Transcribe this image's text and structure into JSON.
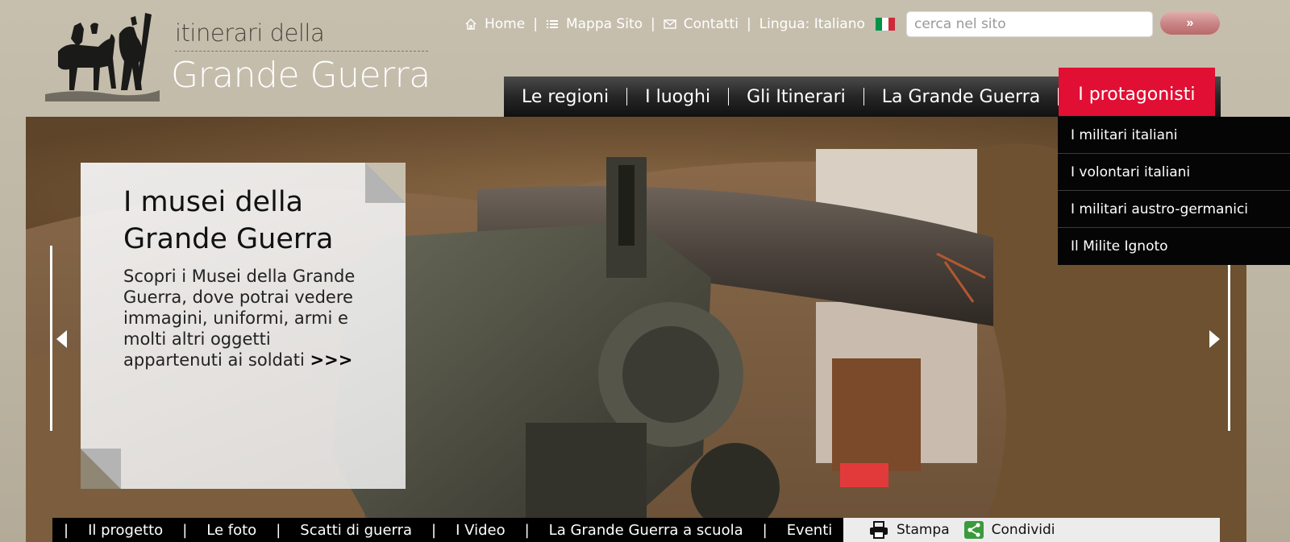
{
  "logo": {
    "line1": "itinerari della",
    "line2": "Grande Guerra"
  },
  "utility": {
    "home": "Home",
    "sitemap": "Mappa Sito",
    "contacts": "Contatti",
    "language_label": "Lingua:",
    "language_value": "Italiano",
    "separator": "|",
    "flag_colors": [
      "#009246",
      "#ffffff",
      "#ce2b37"
    ]
  },
  "search": {
    "placeholder": "cerca nel sito",
    "button_label": "»"
  },
  "mainnav": {
    "items": [
      {
        "label": "Le regioni"
      },
      {
        "label": "I luoghi"
      },
      {
        "label": "Gli Itinerari"
      },
      {
        "label": "La Grande Guerra"
      },
      {
        "label": "I protagonisti",
        "active": true
      }
    ],
    "active_color": "#e10f33"
  },
  "dropdown": {
    "items": [
      {
        "label": "I militari italiani"
      },
      {
        "label": "I volontari italiani"
      },
      {
        "label": "I militari austro-germanici"
      },
      {
        "label": "Il Milite Ignoto"
      }
    ]
  },
  "hero": {
    "title": "I musei della Grande Guerra",
    "text": "Scopri i Musei della Grande Guerra, dove potrai vedere immagini, uniformi, armi e molti altri oggetti appartenuti ai soldati",
    "more": ">>>"
  },
  "bottombar": {
    "items": [
      {
        "label": "Il progetto"
      },
      {
        "label": "Le foto"
      },
      {
        "label": "Scatti di guerra"
      },
      {
        "label": "I Video"
      },
      {
        "label": "La Grande Guerra a scuola"
      },
      {
        "label": "Eventi"
      }
    ],
    "separator": "|",
    "print_label": "Stampa",
    "share_label": "Condividi"
  }
}
